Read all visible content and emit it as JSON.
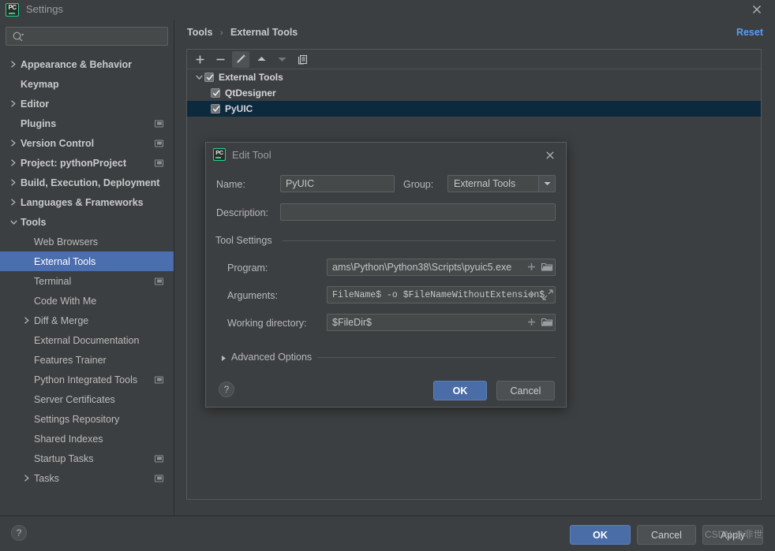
{
  "window": {
    "title": "Settings",
    "logo_text": "PC",
    "close_icon": "close-icon"
  },
  "search": {
    "placeholder": "",
    "value": "",
    "icon": "search-icon"
  },
  "sidebar": {
    "items": [
      {
        "label": "Appearance & Behavior",
        "arrow": "right",
        "bold": true,
        "indent": 0,
        "badge": false,
        "selected": false
      },
      {
        "label": "Keymap",
        "arrow": "none",
        "bold": true,
        "indent": 0,
        "badge": false,
        "selected": false
      },
      {
        "label": "Editor",
        "arrow": "right",
        "bold": true,
        "indent": 0,
        "badge": false,
        "selected": false
      },
      {
        "label": "Plugins",
        "arrow": "none",
        "bold": true,
        "indent": 0,
        "badge": true,
        "selected": false
      },
      {
        "label": "Version Control",
        "arrow": "right",
        "bold": true,
        "indent": 0,
        "badge": true,
        "selected": false
      },
      {
        "label": "Project: pythonProject",
        "arrow": "right",
        "bold": true,
        "indent": 0,
        "badge": true,
        "selected": false
      },
      {
        "label": "Build, Execution, Deployment",
        "arrow": "right",
        "bold": true,
        "indent": 0,
        "badge": false,
        "selected": false
      },
      {
        "label": "Languages & Frameworks",
        "arrow": "right",
        "bold": true,
        "indent": 0,
        "badge": false,
        "selected": false
      },
      {
        "label": "Tools",
        "arrow": "down",
        "bold": true,
        "indent": 0,
        "badge": false,
        "selected": false
      },
      {
        "label": "Web Browsers",
        "arrow": "none",
        "bold": false,
        "indent": 1,
        "badge": false,
        "selected": false
      },
      {
        "label": "External Tools",
        "arrow": "none",
        "bold": false,
        "indent": 1,
        "badge": false,
        "selected": true
      },
      {
        "label": "Terminal",
        "arrow": "none",
        "bold": false,
        "indent": 1,
        "badge": true,
        "selected": false
      },
      {
        "label": "Code With Me",
        "arrow": "none",
        "bold": false,
        "indent": 1,
        "badge": false,
        "selected": false
      },
      {
        "label": "Diff & Merge",
        "arrow": "right",
        "bold": false,
        "indent": 1,
        "badge": false,
        "selected": false
      },
      {
        "label": "External Documentation",
        "arrow": "none",
        "bold": false,
        "indent": 1,
        "badge": false,
        "selected": false
      },
      {
        "label": "Features Trainer",
        "arrow": "none",
        "bold": false,
        "indent": 1,
        "badge": false,
        "selected": false
      },
      {
        "label": "Python Integrated Tools",
        "arrow": "none",
        "bold": false,
        "indent": 1,
        "badge": true,
        "selected": false
      },
      {
        "label": "Server Certificates",
        "arrow": "none",
        "bold": false,
        "indent": 1,
        "badge": false,
        "selected": false
      },
      {
        "label": "Settings Repository",
        "arrow": "none",
        "bold": false,
        "indent": 1,
        "badge": false,
        "selected": false
      },
      {
        "label": "Shared Indexes",
        "arrow": "none",
        "bold": false,
        "indent": 1,
        "badge": false,
        "selected": false
      },
      {
        "label": "Startup Tasks",
        "arrow": "none",
        "bold": false,
        "indent": 1,
        "badge": true,
        "selected": false
      },
      {
        "label": "Tasks",
        "arrow": "right",
        "bold": false,
        "indent": 1,
        "badge": true,
        "selected": false
      }
    ]
  },
  "main": {
    "breadcrumb": {
      "parent": "Tools",
      "separator": "›",
      "current": "External Tools"
    },
    "reset_label": "Reset",
    "toolbar": [
      {
        "name": "add-tool-button",
        "icon": "plus-icon",
        "active": false,
        "dimmed": false
      },
      {
        "name": "remove-tool-button",
        "icon": "minus-icon",
        "active": false,
        "dimmed": false
      },
      {
        "name": "edit-tool-button",
        "icon": "pencil-icon",
        "active": true,
        "dimmed": false
      },
      {
        "name": "move-up-button",
        "icon": "arrow-up-icon",
        "active": false,
        "dimmed": false
      },
      {
        "name": "move-down-button",
        "icon": "arrow-down-icon",
        "active": false,
        "dimmed": true
      },
      {
        "name": "copy-tool-button",
        "icon": "copy-icon",
        "active": false,
        "dimmed": false
      }
    ],
    "tool_tree": [
      {
        "label": "External Tools",
        "checked": true,
        "arrow": "down",
        "child": false,
        "selected": false
      },
      {
        "label": "QtDesigner",
        "checked": true,
        "arrow": "none",
        "child": true,
        "selected": false
      },
      {
        "label": "PyUIC",
        "checked": true,
        "arrow": "none",
        "child": true,
        "selected": true
      }
    ]
  },
  "dialog": {
    "title": "Edit Tool",
    "logo_text": "PC",
    "close_icon": "close-icon",
    "name_label": "Name:",
    "name_value": "PyUIC",
    "group_label": "Group:",
    "group_value": "External Tools",
    "description_label": "Description:",
    "description_value": "",
    "tool_settings_label": "Tool Settings",
    "program_label": "Program:",
    "program_value": "ams\\Python\\Python38\\Scripts\\pyuic5.exe",
    "arguments_label": "Arguments:",
    "arguments_value": "FileName$ -o $FileNameWithoutExtension$",
    "working_dir_label": "Working directory:",
    "working_dir_value": "$FileDir$",
    "advanced_options_label": "Advanced Options",
    "help_label": "?",
    "ok_label": "OK",
    "cancel_label": "Cancel"
  },
  "footer": {
    "ok_label": "OK",
    "cancel_label": "Cancel",
    "apply_label": "Apply",
    "watermark": "CSDN @非世"
  },
  "colors": {
    "background": "#3c3f41",
    "selection_blue": "#4b6eaf",
    "inactive_selection": "#0d293e",
    "accent_link": "#589df6",
    "primary_button": "#4a6da7",
    "logo_green": "#21d789"
  }
}
